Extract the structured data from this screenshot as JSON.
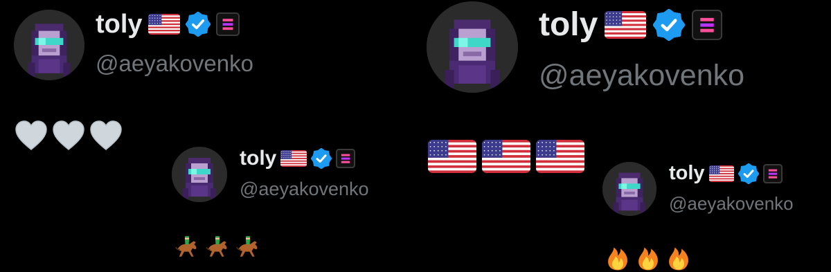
{
  "colors": {
    "background": "#000000",
    "name_text": "#e7e9ea",
    "handle_text": "#71767b",
    "verified_blue": "#1d9bf0",
    "affiliate_badge_accent": "#dc1fff"
  },
  "cards": [
    {
      "name": "toly",
      "handle": "@aeyakovenko",
      "icons": [
        "us-flag-icon",
        "verified-badge-icon",
        "solana-affiliate-badge-icon"
      ],
      "reaction_emoji": [
        "white-heart-icon",
        "white-heart-icon",
        "white-heart-icon"
      ]
    },
    {
      "name": "toly",
      "handle": "@aeyakovenko",
      "icons": [
        "us-flag-icon",
        "verified-badge-icon",
        "solana-affiliate-badge-icon"
      ],
      "reaction_emoji": [
        "horse-racing-icon",
        "horse-racing-icon",
        "horse-racing-icon"
      ]
    },
    {
      "name": "toly",
      "handle": "@aeyakovenko",
      "icons": [
        "us-flag-icon",
        "verified-badge-icon",
        "solana-affiliate-badge-icon"
      ],
      "reaction_emoji": [
        "us-flag-icon",
        "us-flag-icon",
        "us-flag-icon"
      ]
    },
    {
      "name": "toly",
      "handle": "@aeyakovenko",
      "icons": [
        "us-flag-icon",
        "verified-badge-icon",
        "solana-affiliate-badge-icon"
      ],
      "reaction_emoji": [
        "fire-icon",
        "fire-icon",
        "fire-icon"
      ]
    }
  ]
}
